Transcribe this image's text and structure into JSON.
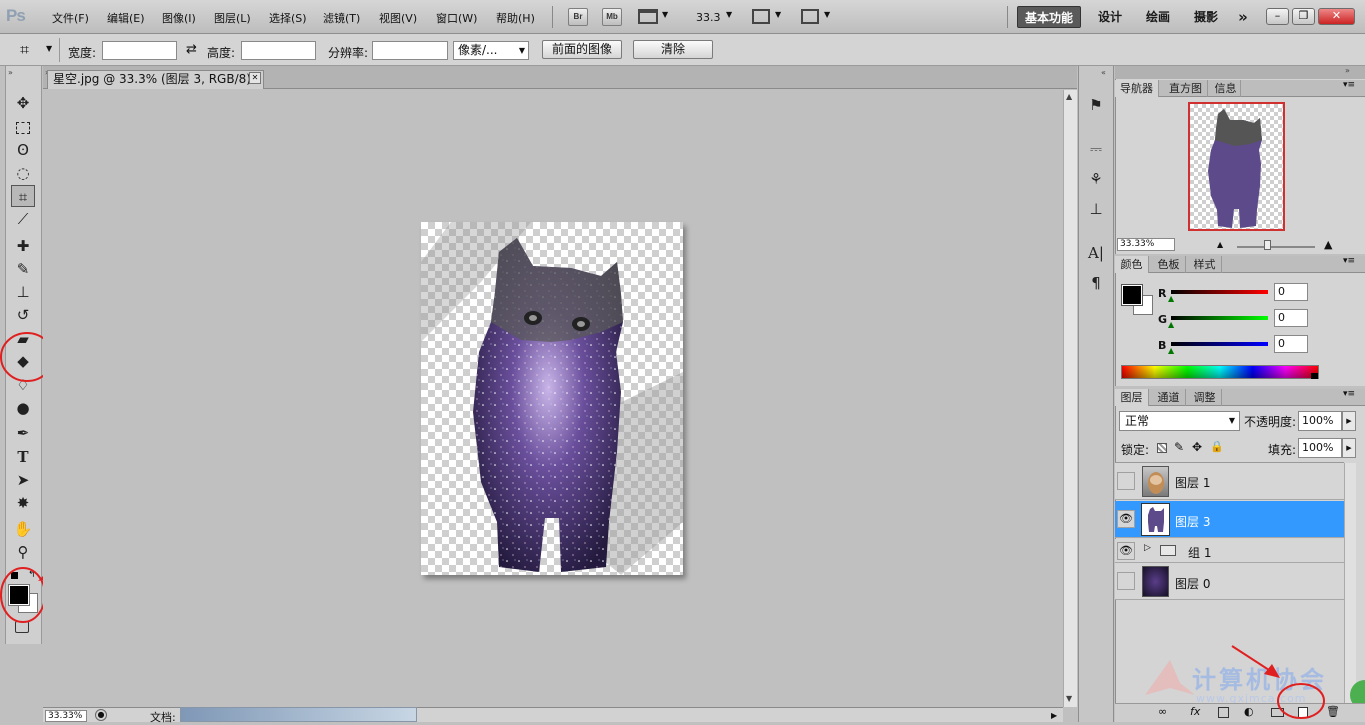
{
  "app_logo": "Ps",
  "menu": [
    "文件(F)",
    "编辑(E)",
    "图像(I)",
    "图层(L)",
    "选择(S)",
    "滤镜(T)",
    "视图(V)",
    "窗口(W)",
    "帮助(H)"
  ],
  "appbar": {
    "bridge": "Br",
    "minibridge": "Mb",
    "zoom": "33.3"
  },
  "workspaces": [
    "基本功能",
    "设计",
    "绘画",
    "摄影"
  ],
  "window_buttons": {
    "min": "–",
    "restore": "❐",
    "close": "✕"
  },
  "options": {
    "width_label": "宽度:",
    "width_value": "",
    "height_label": "高度:",
    "height_value": "",
    "resolution_label": "分辨率:",
    "resolution_value": "",
    "unit": "像素/...",
    "front_image": "前面的图像",
    "clear": "清除"
  },
  "document": {
    "tab_title": "星空.jpg @ 33.3% (图层 3, RGB/8) *",
    "close": "✕"
  },
  "status": {
    "zoom": "33.33%",
    "doc_label": "文档:"
  },
  "navigator": {
    "tabs": [
      "导航器",
      "直方图",
      "信息"
    ],
    "zoom": "33.33%"
  },
  "color_panel": {
    "tabs": [
      "颜色",
      "色板",
      "样式"
    ],
    "channels": [
      {
        "label": "R",
        "value": "0",
        "color": "#cc0000"
      },
      {
        "label": "G",
        "value": "0",
        "color": "#00bb00"
      },
      {
        "label": "B",
        "value": "0",
        "color": "#0000cc"
      }
    ]
  },
  "layers_panel": {
    "tabs": [
      "图层",
      "通道",
      "调整"
    ],
    "blend_mode": "正常",
    "opacity_label": "不透明度:",
    "opacity": "100%",
    "lock_label": "锁定:",
    "fill_label": "填充:",
    "fill": "100%",
    "layers": [
      {
        "name": "图层 1",
        "visible": false,
        "selected": false
      },
      {
        "name": "图层 3",
        "visible": true,
        "selected": true
      },
      {
        "name": "组 1",
        "visible": true,
        "selected": false,
        "group": true
      },
      {
        "name": "图层 0",
        "visible": false,
        "selected": false
      }
    ]
  },
  "watermark": {
    "text": "计算机协会",
    "url": "www.gxjmca.com"
  },
  "colors": {
    "accent": "#3399ff",
    "annotation": "#e02020"
  }
}
